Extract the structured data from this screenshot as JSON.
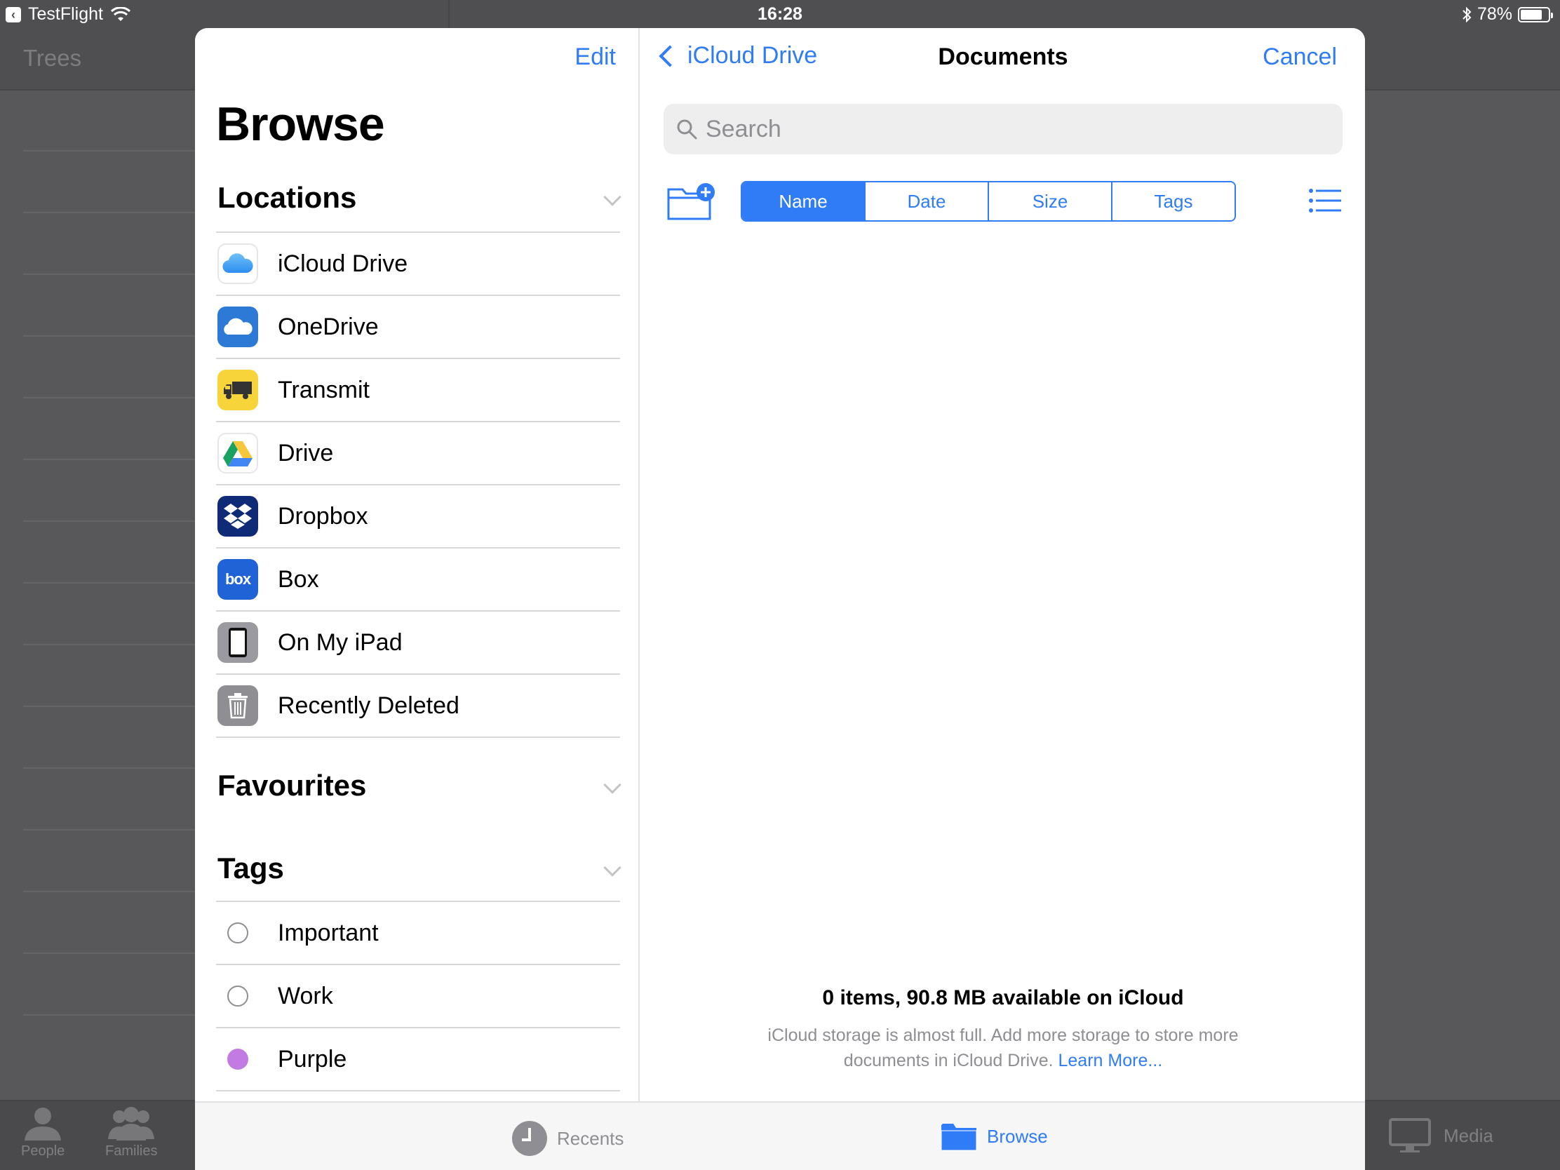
{
  "status_bar": {
    "back_app": "TestFlight",
    "time": "16:28",
    "battery": "78%",
    "battery_level": 0.78
  },
  "background": {
    "title": "Trees",
    "tabs": [
      {
        "label": "People",
        "icon": "person-icon"
      },
      {
        "label": "Families",
        "icon": "people-icon"
      },
      {
        "label": "Media",
        "icon": "monitor-icon"
      }
    ]
  },
  "sidebar": {
    "edit_label": "Edit",
    "title": "Browse",
    "locations_header": "Locations",
    "locations": [
      {
        "label": "iCloud Drive",
        "icon": "icloud-icon"
      },
      {
        "label": "OneDrive",
        "icon": "onedrive-icon"
      },
      {
        "label": "Transmit",
        "icon": "truck-icon"
      },
      {
        "label": "Drive",
        "icon": "google-drive-icon"
      },
      {
        "label": "Dropbox",
        "icon": "dropbox-icon"
      },
      {
        "label": "Box",
        "icon": "box-icon"
      },
      {
        "label": "On My iPad",
        "icon": "ipad-icon"
      },
      {
        "label": "Recently Deleted",
        "icon": "trash-icon"
      }
    ],
    "favourites_header": "Favourites",
    "tags_header": "Tags",
    "tags": [
      {
        "label": "Important",
        "color": ""
      },
      {
        "label": "Work",
        "color": ""
      },
      {
        "label": "Purple",
        "color": "#c27be3"
      }
    ]
  },
  "detail": {
    "back_label": "iCloud Drive",
    "title": "Documents",
    "cancel_label": "Cancel",
    "search_placeholder": "Search",
    "sort_options": [
      "Name",
      "Date",
      "Size",
      "Tags"
    ],
    "sort_selected": "Name",
    "footer_main": "0 items, 90.8 MB available on iCloud",
    "footer_sub": "iCloud storage is almost full. Add more storage to store more documents in iCloud Drive.",
    "footer_link": "Learn More..."
  },
  "tabbar": {
    "recents_label": "Recents",
    "browse_label": "Browse"
  },
  "colors": {
    "accent": "#2f7cf6",
    "purple_tag": "#c27be3"
  }
}
